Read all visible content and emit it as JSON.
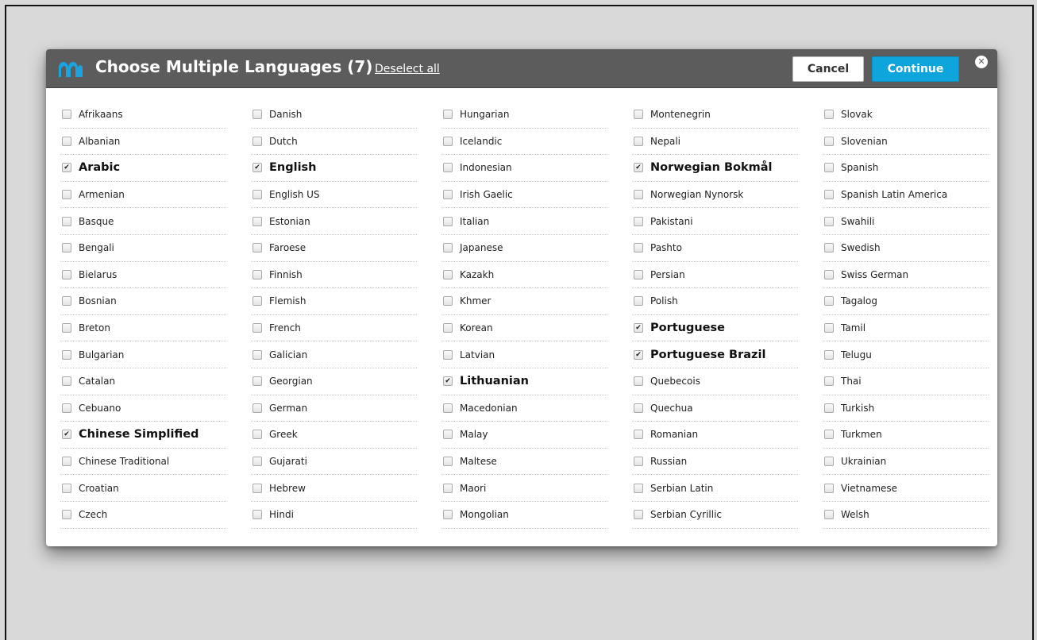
{
  "dialog": {
    "title": "Choose Multiple Languages (7)",
    "deselect_label": "Deselect all",
    "cancel_label": "Cancel",
    "continue_label": "Continue",
    "close_symbol": "✕",
    "logo_icon": "m-logo-icon",
    "colors": {
      "header": "#5c5c5c",
      "continue": "#0ea5dc",
      "logo": "#1aa3dc"
    }
  },
  "checkbox_mark": "✔",
  "columns": [
    {
      "items": [
        {
          "label": "Afrikaans",
          "checked": false
        },
        {
          "label": "Albanian",
          "checked": false
        },
        {
          "label": "Arabic",
          "checked": true
        },
        {
          "label": "Armenian",
          "checked": false
        },
        {
          "label": "Basque",
          "checked": false
        },
        {
          "label": "Bengali",
          "checked": false
        },
        {
          "label": "Bielarus",
          "checked": false
        },
        {
          "label": "Bosnian",
          "checked": false
        },
        {
          "label": "Breton",
          "checked": false
        },
        {
          "label": "Bulgarian",
          "checked": false
        },
        {
          "label": "Catalan",
          "checked": false
        },
        {
          "label": "Cebuano",
          "checked": false
        },
        {
          "label": "Chinese Simplified",
          "checked": true
        },
        {
          "label": "Chinese Traditional",
          "checked": false
        },
        {
          "label": "Croatian",
          "checked": false
        },
        {
          "label": "Czech",
          "checked": false
        }
      ]
    },
    {
      "items": [
        {
          "label": "Danish",
          "checked": false
        },
        {
          "label": "Dutch",
          "checked": false
        },
        {
          "label": "English",
          "checked": true
        },
        {
          "label": "English US",
          "checked": false
        },
        {
          "label": "Estonian",
          "checked": false
        },
        {
          "label": "Faroese",
          "checked": false
        },
        {
          "label": "Finnish",
          "checked": false
        },
        {
          "label": "Flemish",
          "checked": false
        },
        {
          "label": "French",
          "checked": false
        },
        {
          "label": "Galician",
          "checked": false
        },
        {
          "label": "Georgian",
          "checked": false
        },
        {
          "label": "German",
          "checked": false
        },
        {
          "label": "Greek",
          "checked": false
        },
        {
          "label": "Gujarati",
          "checked": false
        },
        {
          "label": "Hebrew",
          "checked": false
        },
        {
          "label": "Hindi",
          "checked": false
        }
      ]
    },
    {
      "items": [
        {
          "label": "Hungarian",
          "checked": false
        },
        {
          "label": "Icelandic",
          "checked": false
        },
        {
          "label": "Indonesian",
          "checked": false
        },
        {
          "label": "Irish Gaelic",
          "checked": false
        },
        {
          "label": "Italian",
          "checked": false
        },
        {
          "label": "Japanese",
          "checked": false
        },
        {
          "label": "Kazakh",
          "checked": false
        },
        {
          "label": "Khmer",
          "checked": false
        },
        {
          "label": "Korean",
          "checked": false
        },
        {
          "label": "Latvian",
          "checked": false
        },
        {
          "label": "Lithuanian",
          "checked": true
        },
        {
          "label": "Macedonian",
          "checked": false
        },
        {
          "label": "Malay",
          "checked": false
        },
        {
          "label": "Maltese",
          "checked": false
        },
        {
          "label": "Maori",
          "checked": false
        },
        {
          "label": "Mongolian",
          "checked": false
        }
      ]
    },
    {
      "items": [
        {
          "label": "Montenegrin",
          "checked": false
        },
        {
          "label": "Nepali",
          "checked": false
        },
        {
          "label": "Norwegian Bokmål",
          "checked": true
        },
        {
          "label": "Norwegian Nynorsk",
          "checked": false
        },
        {
          "label": "Pakistani",
          "checked": false
        },
        {
          "label": "Pashto",
          "checked": false
        },
        {
          "label": "Persian",
          "checked": false
        },
        {
          "label": "Polish",
          "checked": false
        },
        {
          "label": "Portuguese",
          "checked": true
        },
        {
          "label": "Portuguese Brazil",
          "checked": true
        },
        {
          "label": "Quebecois",
          "checked": false
        },
        {
          "label": "Quechua",
          "checked": false
        },
        {
          "label": "Romanian",
          "checked": false
        },
        {
          "label": "Russian",
          "checked": false
        },
        {
          "label": "Serbian Latin",
          "checked": false
        },
        {
          "label": "Serbian Cyrillic",
          "checked": false
        }
      ]
    },
    {
      "items": [
        {
          "label": "Slovak",
          "checked": false
        },
        {
          "label": "Slovenian",
          "checked": false
        },
        {
          "label": "Spanish",
          "checked": false
        },
        {
          "label": "Spanish Latin America",
          "checked": false
        },
        {
          "label": "Swahili",
          "checked": false
        },
        {
          "label": "Swedish",
          "checked": false
        },
        {
          "label": "Swiss German",
          "checked": false
        },
        {
          "label": "Tagalog",
          "checked": false
        },
        {
          "label": "Tamil",
          "checked": false
        },
        {
          "label": "Telugu",
          "checked": false
        },
        {
          "label": "Thai",
          "checked": false
        },
        {
          "label": "Turkish",
          "checked": false
        },
        {
          "label": "Turkmen",
          "checked": false
        },
        {
          "label": "Ukrainian",
          "checked": false
        },
        {
          "label": "Vietnamese",
          "checked": false
        },
        {
          "label": "Welsh",
          "checked": false
        }
      ]
    }
  ]
}
